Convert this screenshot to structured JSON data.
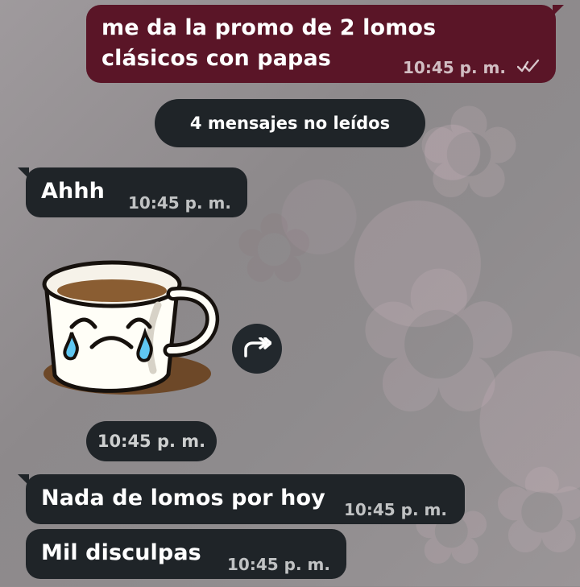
{
  "messages": [
    {
      "text": "me da la promo de 2 lomos clásicos con papas",
      "line1": "me da la promo de 2 lomos",
      "line2": "clásicos con papas",
      "time": "10:45 p. m.",
      "status_icon": "double-check-icon",
      "type": "outgoing"
    },
    {
      "text": "Ahhh",
      "time": "10:45 p. m.",
      "type": "incoming"
    },
    {
      "sticker_name": "crying-coffee-cup-sticker",
      "time": "10:45 p. m.",
      "type": "incoming"
    },
    {
      "text": "Nada de lomos por hoy",
      "time": "10:45 p. m.",
      "type": "incoming"
    },
    {
      "text": "Mil disculpas",
      "time": "10:45 p. m.",
      "type": "incoming"
    }
  ],
  "unread_banner": {
    "text": "4 mensajes no leídos"
  },
  "icons": {
    "forward": "forward-arrow-icon",
    "read_status": "double-check-icon"
  },
  "colors": {
    "outgoing_bubble": "#5a1527",
    "incoming_bubble": "#1f2428",
    "background": "#8f8b8d"
  }
}
